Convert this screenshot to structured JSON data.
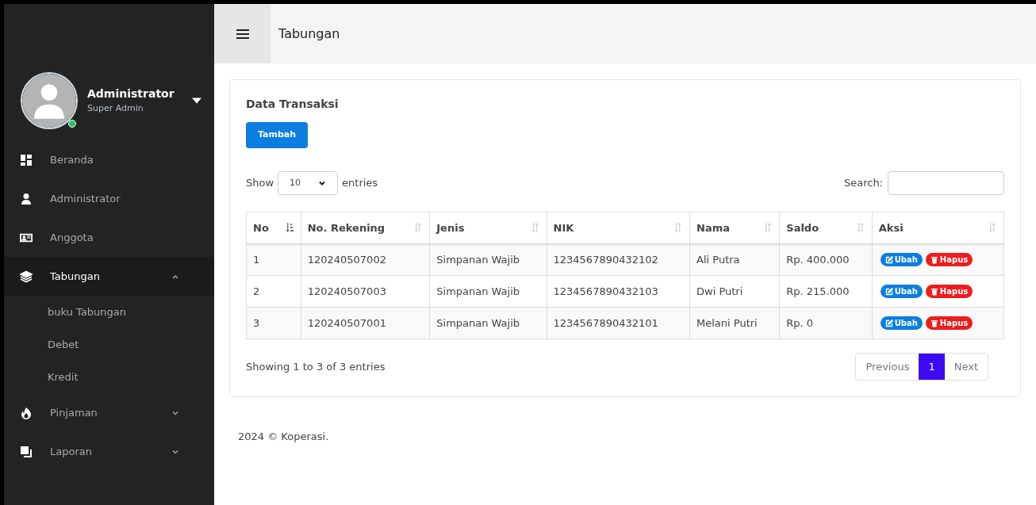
{
  "header": {
    "title": "Tabungan"
  },
  "user": {
    "name": "Administrator",
    "role": "Super Admin",
    "online": true
  },
  "sidebar": {
    "items": [
      {
        "label": "Beranda",
        "selected": false
      },
      {
        "label": "Administrator",
        "selected": false
      },
      {
        "label": "Anggota",
        "selected": false
      },
      {
        "label": "Tabungan",
        "selected": true,
        "expanded": true,
        "children": [
          {
            "label": "buku Tabungan"
          },
          {
            "label": "Debet"
          },
          {
            "label": "Kredit"
          }
        ]
      },
      {
        "label": "Pinjaman",
        "selected": false,
        "expanded": false
      },
      {
        "label": "Laporan",
        "selected": false,
        "expanded": false
      }
    ]
  },
  "card": {
    "title": "Data Transaksi",
    "add_button": "Tambah",
    "length": {
      "before": "Show",
      "value": "10",
      "after": "entries"
    },
    "search": {
      "label": "Search:"
    },
    "table": {
      "columns": [
        {
          "label": "No",
          "sorted": true
        },
        {
          "label": "No. Rekening",
          "sorted": false
        },
        {
          "label": "Jenis",
          "sorted": false
        },
        {
          "label": "NIK",
          "sorted": false
        },
        {
          "label": "Nama",
          "sorted": false
        },
        {
          "label": "Saldo",
          "sorted": false
        },
        {
          "label": "Aksi",
          "sorted": false
        }
      ],
      "rows": [
        {
          "cells": [
            "1",
            "120240507002",
            "Simpanan Wajib",
            "1234567890432102",
            "Ali Putra",
            "Rp. 400.000"
          ],
          "actions": [
            "Ubah",
            "Hapus"
          ]
        },
        {
          "cells": [
            "2",
            "120240507003",
            "Simpanan Wajib",
            "1234567890432103",
            "Dwi Putri",
            "Rp. 215.000"
          ],
          "actions": [
            "Ubah",
            "Hapus"
          ]
        },
        {
          "cells": [
            "3",
            "120240507001",
            "Simpanan Wajib",
            "1234567890432101",
            "Melani Putri",
            "Rp. 0"
          ],
          "actions": [
            "Ubah",
            "Hapus"
          ]
        }
      ]
    },
    "info": "Showing 1 to 3 of 3 entries",
    "pagination": {
      "previous": "Previous",
      "pages": [
        {
          "label": "1",
          "selected": true
        }
      ],
      "next": "Next"
    }
  },
  "footer": "2024 © Koperasi."
}
